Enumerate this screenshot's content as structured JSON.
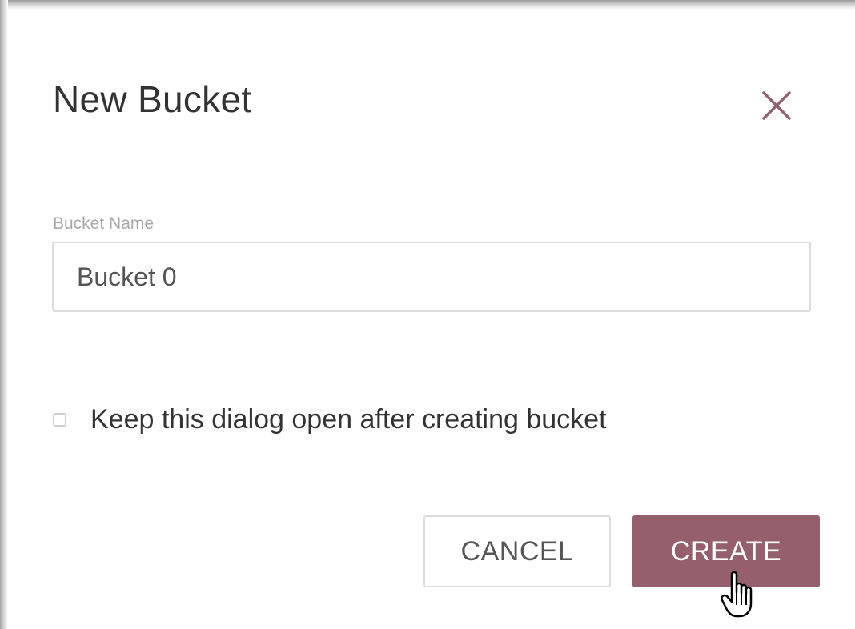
{
  "dialog": {
    "title": "New Bucket",
    "close_icon": "close-x-icon",
    "bucket_name": {
      "label": "Bucket Name",
      "value": "Bucket 0"
    },
    "keep_open": {
      "label": "Keep this dialog open after creating bucket",
      "checked": false
    },
    "buttons": {
      "cancel_label": "CANCEL",
      "create_label": "CREATE"
    },
    "cursor_icon": "hand-pointer-icon"
  },
  "colors": {
    "accent": "#955f6b",
    "title_text": "#333333",
    "label_text": "#a7a7a7",
    "border": "#dcdcdc"
  }
}
